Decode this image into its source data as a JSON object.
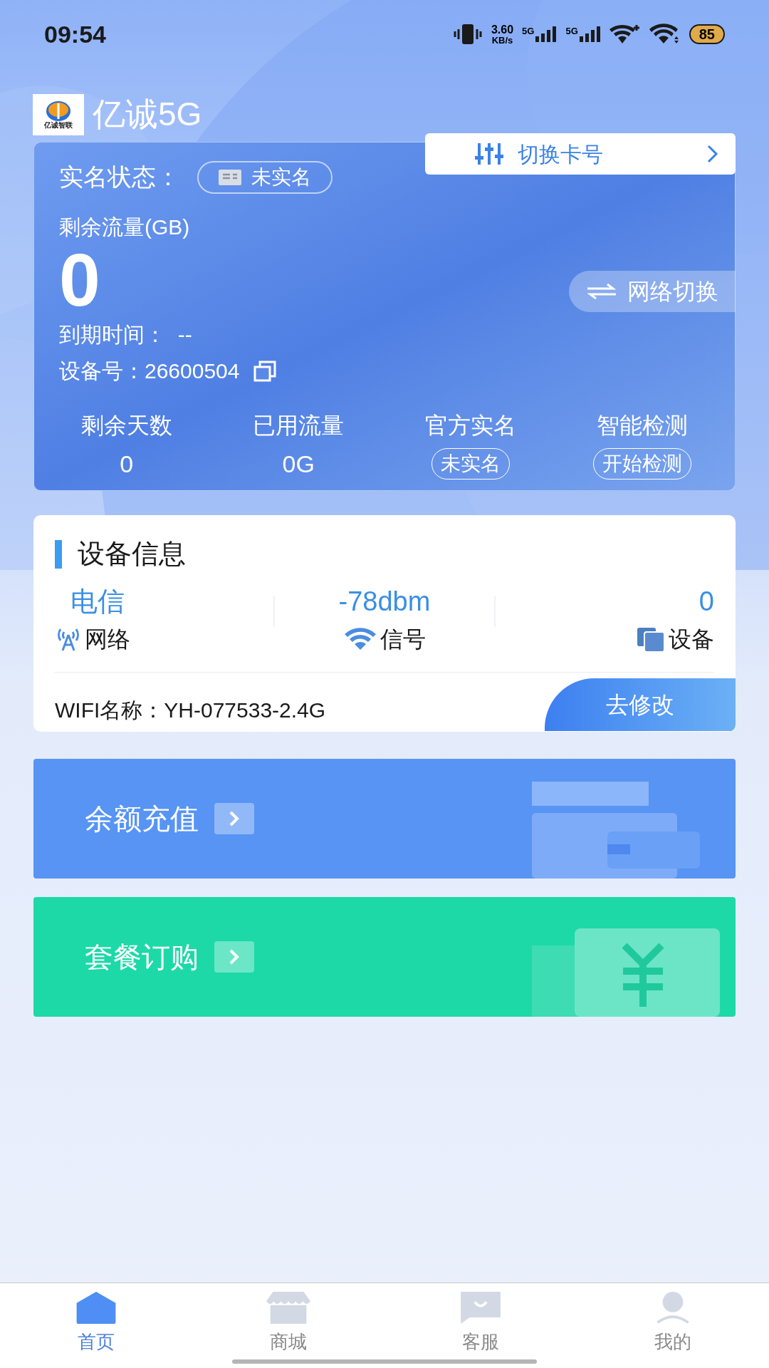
{
  "status_bar": {
    "time": "09:54",
    "speed_value": "3.60",
    "speed_unit": "KB/s",
    "sims": [
      "5G",
      "5G"
    ],
    "battery": "85"
  },
  "header": {
    "logo_text": "亿诚智联",
    "title": "亿诚5G"
  },
  "card": {
    "realname_label": "实名状态：",
    "realname_badge": "未实名",
    "switch_card": "切换卡号",
    "remaining_label": "剩余流量(GB)",
    "remaining": "0",
    "network_switch": "网络切换",
    "expiry": "到期时间：  --",
    "device_no": "设备号：26600504",
    "stats": [
      {
        "label": "剩余天数",
        "value": "0",
        "kind": "text"
      },
      {
        "label": "已用流量",
        "value": "0G",
        "kind": "text"
      },
      {
        "label": "官方实名",
        "value": "未实名",
        "kind": "button"
      },
      {
        "label": "智能检测",
        "value": "开始检测",
        "kind": "button"
      }
    ]
  },
  "device_info": {
    "title": "设备信息",
    "items": [
      {
        "value": "电信",
        "label": "网络",
        "kind": "antenna"
      },
      {
        "value": "-78dbm",
        "label": "信号",
        "kind": "wifi"
      },
      {
        "value": "0",
        "label": "设备",
        "kind": "devices"
      }
    ],
    "wifi": "WIFI名称：YH-077533-2.4G",
    "edit": "去修改"
  },
  "actions": [
    {
      "label": "余额充值",
      "kind": "recharge"
    },
    {
      "label": "套餐订购",
      "kind": "package"
    }
  ],
  "nav": [
    {
      "label": "首页",
      "kind": "home",
      "selected": true
    },
    {
      "label": "商城",
      "kind": "shop",
      "selected": false
    },
    {
      "label": "客服",
      "kind": "chat",
      "selected": false
    },
    {
      "label": "我的",
      "kind": "user",
      "selected": false
    }
  ]
}
